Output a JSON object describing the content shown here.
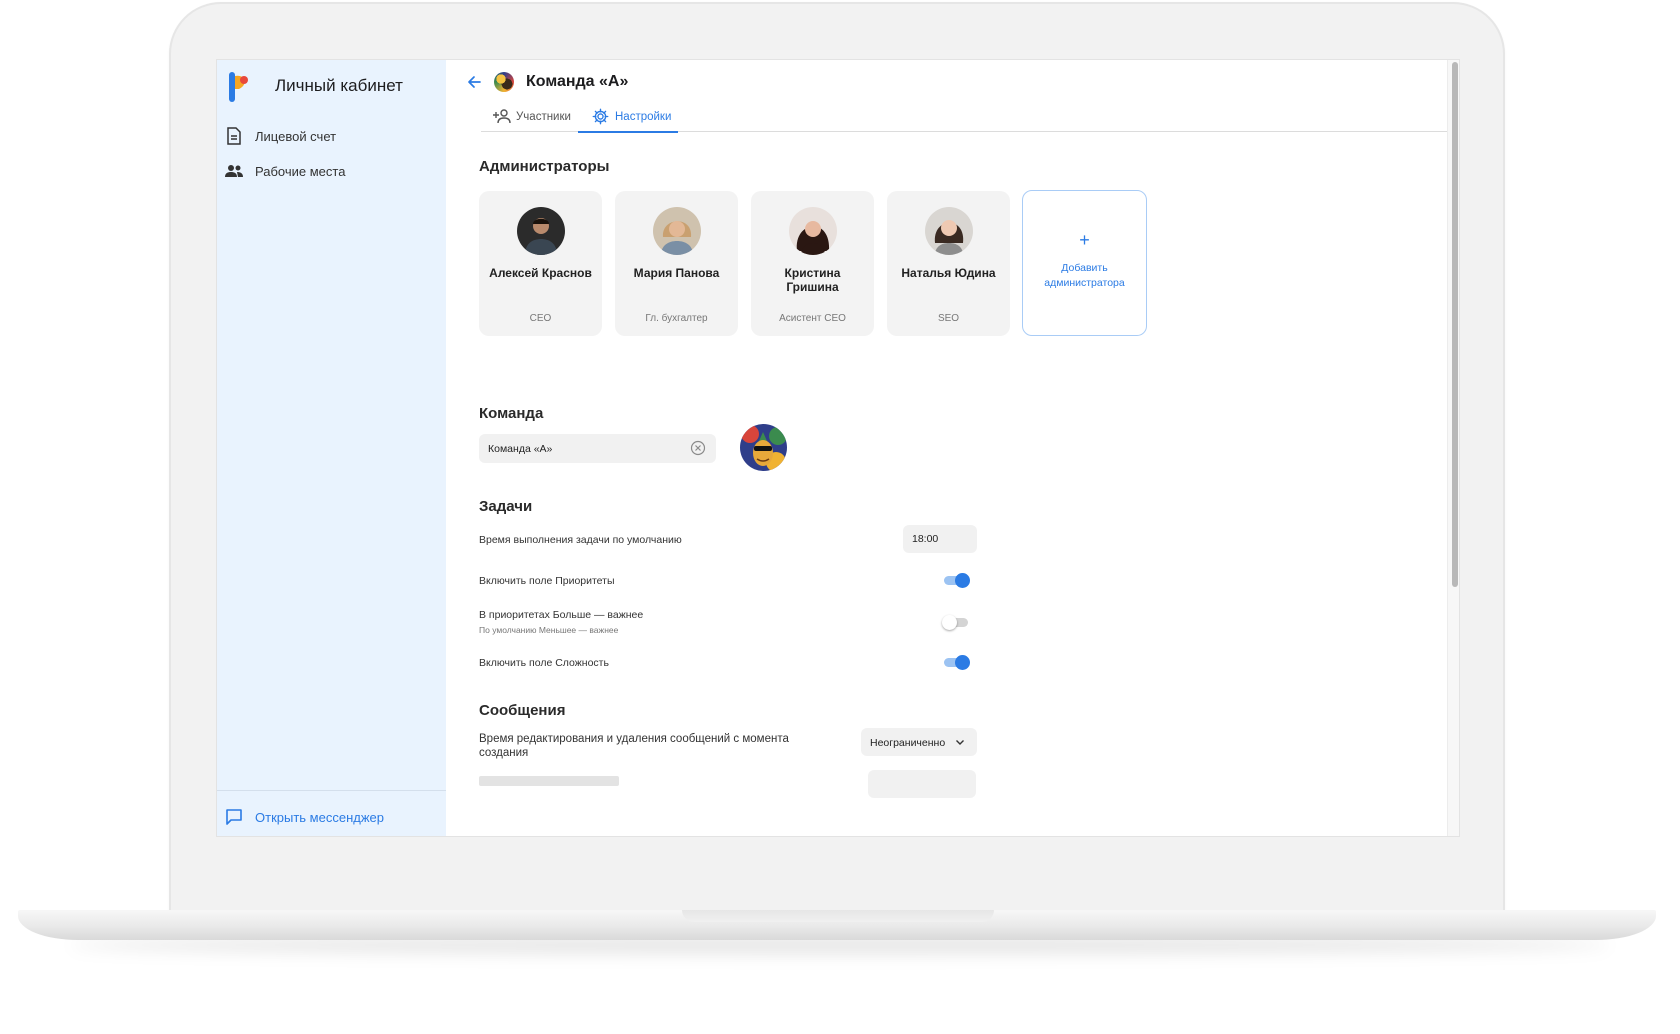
{
  "sidebar": {
    "title": "Личный кабинет",
    "items": [
      {
        "label": "Лицевой счет",
        "icon": "document-icon"
      },
      {
        "label": "Рабочие места",
        "icon": "people-icon"
      }
    ],
    "footer_link": "Открыть мессенджер"
  },
  "header": {
    "title": "Команда «А»"
  },
  "tabs": [
    {
      "label": "Участники",
      "icon": "add-person-icon",
      "active": false
    },
    {
      "label": "Настройки",
      "icon": "gear-icon",
      "active": true
    }
  ],
  "admins": {
    "title": "Администраторы",
    "cards": [
      {
        "name": "Алексей Краснов",
        "role": "CEO"
      },
      {
        "name": "Мария Панова",
        "role": "Гл. бухгалтер"
      },
      {
        "name": "Кристина Гришина",
        "role": "Асистент CEO"
      },
      {
        "name": "Наталья Юдина",
        "role": "SEO"
      }
    ],
    "add_label": "Добавить администратора",
    "add_symbol": "+"
  },
  "team": {
    "title": "Команда",
    "name_value": "Команда «А»"
  },
  "tasks": {
    "title": "Задачи",
    "default_time_label": "Время выполнения задачи по умолчанию",
    "default_time_value": "18:00",
    "priority_label": "Включить поле Приоритеты",
    "priority_on": true,
    "priority_order_label": "В приоритетах Больше — важнее",
    "priority_order_sub": "По умолчанию Меньшее — важнее",
    "priority_order_on": false,
    "complexity_label": "Включить поле Сложность",
    "complexity_on": true
  },
  "messages": {
    "title": "Сообщения",
    "edit_time_label": "Время редактирования и удаления сообщений с момента создания",
    "edit_time_value": "Неограниченно"
  },
  "colors": {
    "accent": "#2b7be4",
    "sidebar_bg": "#e9f3fe",
    "card_bg": "#f3f3f3"
  }
}
